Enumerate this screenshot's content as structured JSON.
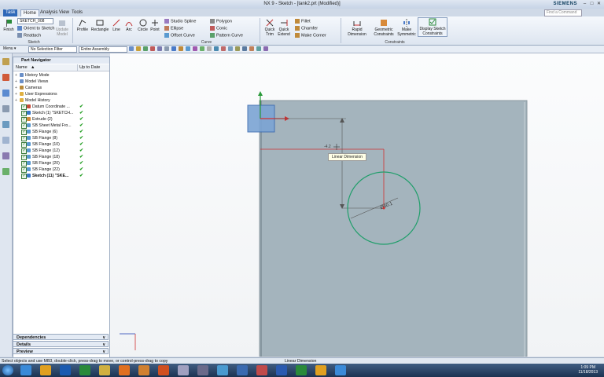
{
  "window": {
    "title": "NX 9 - Sketch - [tank2.prt (Modified)]",
    "brand": "SIEMENS"
  },
  "tabs": [
    "Task",
    "Home",
    "Analysis",
    "View",
    "Tools"
  ],
  "command_finder_placeholder": "Find a Command",
  "ribbon": {
    "sketch_group": {
      "label": "Sketch",
      "sketch_name": "SKETCH_008",
      "finish": "Finish",
      "orient": "Orient to Sketch",
      "reattach": "Reattach",
      "update_model": "Update Model"
    },
    "curve_group": {
      "label": "Curve",
      "profile": "Profile",
      "rectangle": "Rectangle",
      "line": "Line",
      "arc": "Arc",
      "circle": "Circle",
      "point": "Point",
      "studio_spline": "Studio Spline",
      "ellipse": "Ellipse",
      "offset_curve": "Offset Curve",
      "polygon": "Polygon",
      "conic": "Conic",
      "pattern_curve": "Pattern Curve",
      "quick_trim": "Quick Trim",
      "quick_extend": "Quick Extend",
      "fillet": "Fillet",
      "chamfer": "Chamfer",
      "make_corner": "Make Corner"
    },
    "constraints_group": {
      "label": "Constraints",
      "rapid_dimension": "Rapid Dimension",
      "geometric_constraints": "Geometric Constraints",
      "make_symmetric": "Make Symmetric",
      "display_sketch_constraints": "Display Sketch Constraints"
    }
  },
  "toolbar2": {
    "menu": "Menu",
    "selection_filter": "No Selection Filter",
    "scope": "Entire Assembly"
  },
  "part_navigator": {
    "title": "Part Navigator",
    "col_name": "Name",
    "col_uptodate": "Up to Date",
    "items": [
      {
        "label": "History Mode",
        "indent": 0,
        "icon": "#6a8fc8",
        "check": false,
        "box": false
      },
      {
        "label": "Model Views",
        "indent": 0,
        "icon": "#6a8fc8",
        "check": false,
        "box": false
      },
      {
        "label": "Cameras",
        "indent": 0,
        "icon": "#b88a3a",
        "check": false,
        "box": false
      },
      {
        "label": "User Expressions",
        "indent": 0,
        "icon": "#e0b040",
        "check": false,
        "box": false
      },
      {
        "label": "Model History",
        "indent": 0,
        "icon": "#e0b040",
        "check": false,
        "box": false
      },
      {
        "label": "Datum Coordinate ...",
        "indent": 1,
        "icon": "#c84a3a",
        "check": true,
        "box": true
      },
      {
        "label": "Sketch (1) \"SKETCH...",
        "indent": 1,
        "icon": "#3a78c8",
        "check": true,
        "box": true
      },
      {
        "label": "Extrude (2)",
        "indent": 1,
        "icon": "#d08a3a",
        "check": true,
        "box": true
      },
      {
        "label": "SB Sheet Metal Fro...",
        "indent": 1,
        "icon": "#5a9ad0",
        "check": true,
        "box": true
      },
      {
        "label": "SB Flange (6)",
        "indent": 1,
        "icon": "#5a9ad0",
        "check": true,
        "box": true
      },
      {
        "label": "SB Flange (8)",
        "indent": 1,
        "icon": "#5a9ad0",
        "check": true,
        "box": true
      },
      {
        "label": "SB Flange (10)",
        "indent": 1,
        "icon": "#5a9ad0",
        "check": true,
        "box": true
      },
      {
        "label": "SB Flange (12)",
        "indent": 1,
        "icon": "#5a9ad0",
        "check": true,
        "box": true
      },
      {
        "label": "SB Flange (18)",
        "indent": 1,
        "icon": "#5a9ad0",
        "check": true,
        "box": true
      },
      {
        "label": "SB Flange (20)",
        "indent": 1,
        "icon": "#5a9ad0",
        "check": true,
        "box": true
      },
      {
        "label": "SB Flange (22)",
        "indent": 1,
        "icon": "#5a9ad0",
        "check": true,
        "box": true
      },
      {
        "label": "Sketch (11) \"SKE...",
        "indent": 1,
        "icon": "#3a78c8",
        "check": true,
        "box": true
      }
    ]
  },
  "accordions": [
    "Dependencies",
    "Details",
    "Preview"
  ],
  "canvas": {
    "tooltip": "Linear Dimension",
    "circle_dim": "Ø60.1",
    "cursor_coords": "-4.2"
  },
  "status": {
    "left": "Select objects and use MB3, double-click, press-drag to move, or control-press-drag to copy",
    "center": "Linear Dimension"
  },
  "clock": {
    "time": "1:09 PM",
    "date": "11/18/2013"
  },
  "colors": {
    "sheet": "#a4b4bd",
    "circle": "#1f9e6a",
    "dimension": "#d03030",
    "task_tab": "#2e68b8"
  }
}
